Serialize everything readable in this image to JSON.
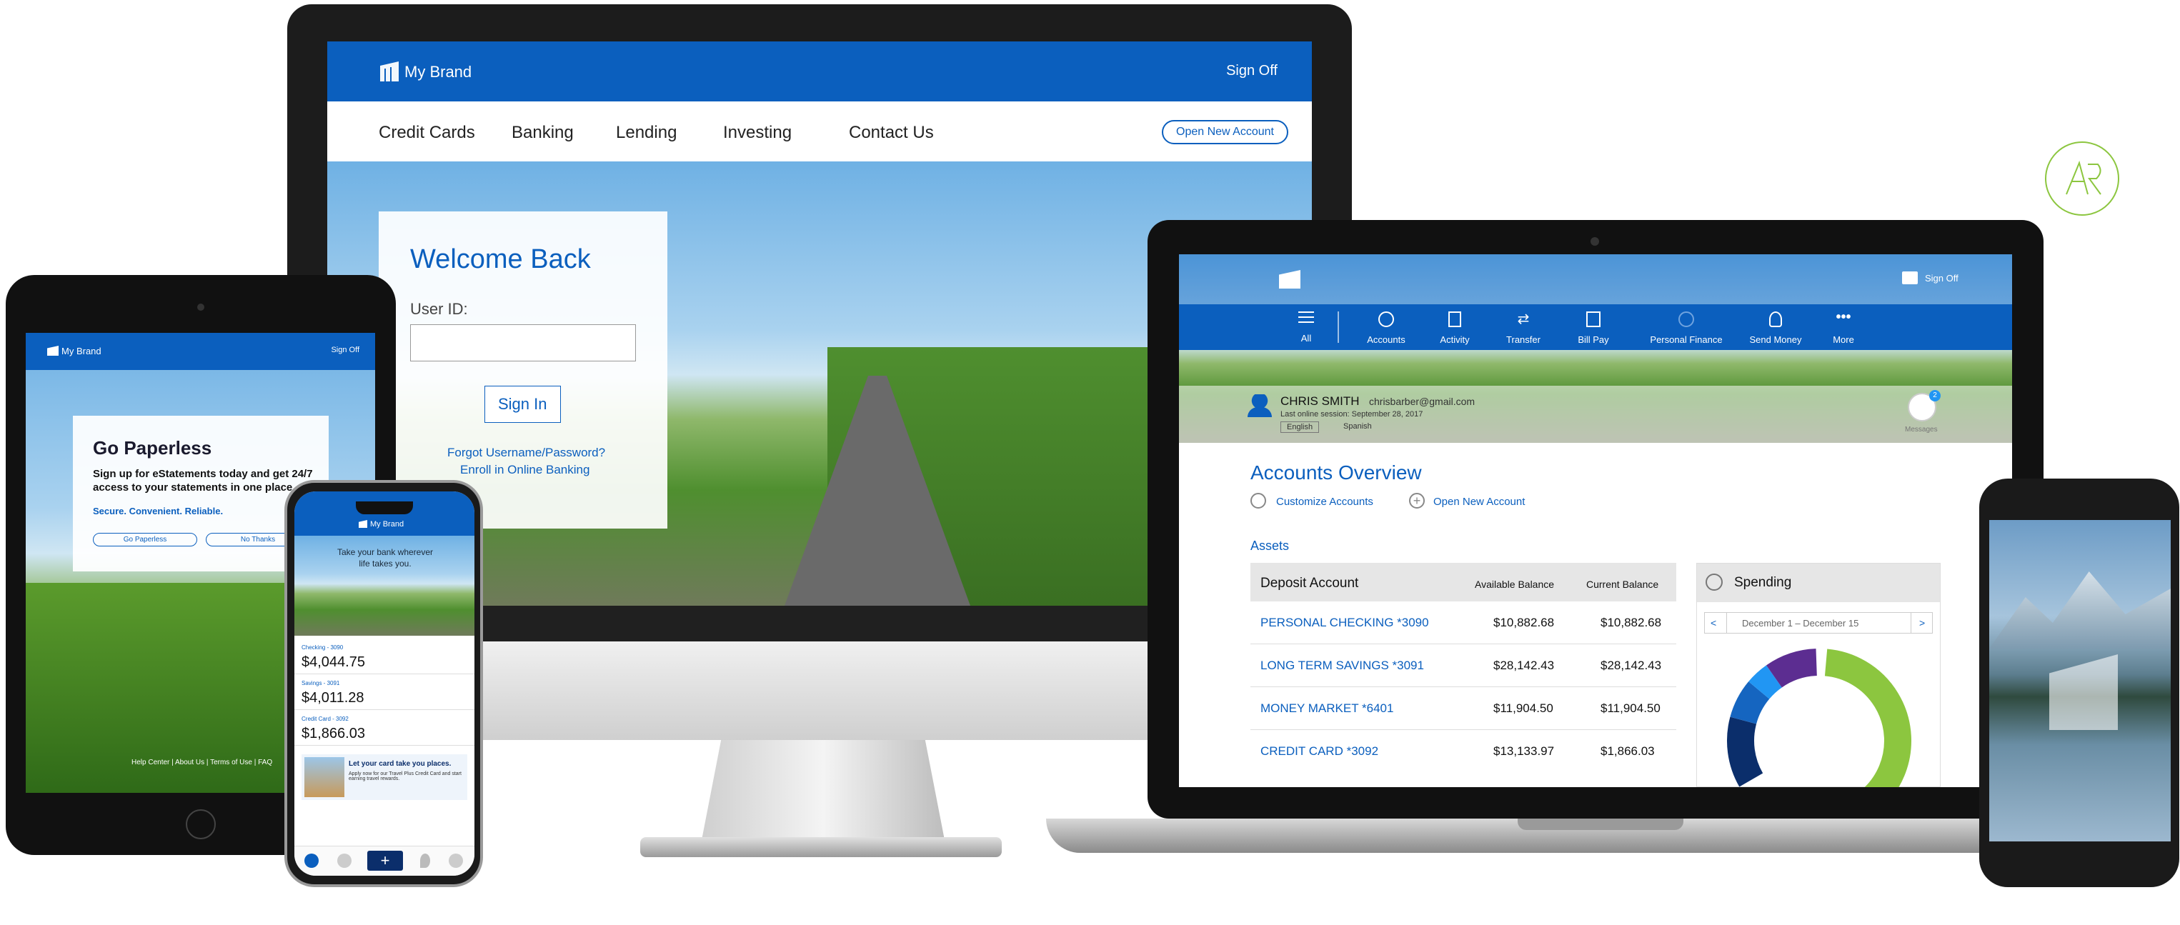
{
  "monitor": {
    "brand": "My Brand",
    "sign_off": "Sign Off",
    "nav": [
      "Credit Cards",
      "Banking",
      "Lending",
      "Investing",
      "Contact Us"
    ],
    "open_account": "Open New Account",
    "login": {
      "title": "Welcome Back",
      "user_label": "User ID:",
      "sign_in": "Sign In",
      "forgot": "Forgot Username/Password?",
      "enroll": "Enroll in Online Banking"
    }
  },
  "laptop": {
    "sign_off": "Sign Off",
    "nav": [
      {
        "label": "All",
        "icon": "menu-icon"
      },
      {
        "label": "Accounts",
        "icon": "accounts-icon"
      },
      {
        "label": "Activity",
        "icon": "activity-icon"
      },
      {
        "label": "Transfer",
        "icon": "transfer-icon"
      },
      {
        "label": "Bill Pay",
        "icon": "bill-pay-icon"
      },
      {
        "label": "Personal Finance",
        "icon": "personal-finance-icon"
      },
      {
        "label": "Send Money",
        "icon": "send-money-icon"
      },
      {
        "label": "More",
        "icon": "more-icon"
      }
    ],
    "user": {
      "name": "CHRIS SMITH",
      "email": "chrisbarber@gmail.com",
      "last_session": "Last online session: September 28, 2017",
      "lang_en": "English",
      "lang_es": "Spanish",
      "messages": "Messages",
      "messages_count": "2"
    },
    "overview_title": "Accounts Overview",
    "customize": "Customize Accounts",
    "open_account": "Open New Account",
    "assets": "Assets",
    "table": {
      "headers": [
        "Deposit Account",
        "Available Balance",
        "Current Balance"
      ],
      "rows": [
        [
          "PERSONAL CHECKING *3090",
          "$10,882.68",
          "$10,882.68"
        ],
        [
          "LONG TERM SAVINGS *3091",
          "$28,142.43",
          "$28,142.43"
        ],
        [
          "MONEY MARKET *6401",
          "$11,904.50",
          "$11,904.50"
        ],
        [
          "CREDIT CARD *3092",
          "$13,133.97",
          "$1,866.03"
        ]
      ]
    },
    "spending": {
      "title": "Spending",
      "range": "December 1 – December 15",
      "prev": "<",
      "next": ">",
      "colors": [
        "#8cc63f",
        "#0b2e6b",
        "#1565c0",
        "#2196f3",
        "#5c2d91"
      ]
    }
  },
  "tablet": {
    "brand": "My Brand",
    "sign_off": "Sign Off",
    "title": "Go Paperless",
    "body": "Sign up for eStatements today and get 24/7 access to your statements in one place.",
    "tagline": "Secure. Convenient. Reliable.",
    "btn_yes": "Go Paperless",
    "btn_no": "No Thanks",
    "footer": "Help Center | About Us | Terms of Use | FAQ"
  },
  "phone": {
    "brand": "My Brand",
    "hero_line1": "Take your bank wherever",
    "hero_line2": "life takes you.",
    "accounts": [
      {
        "label": "Checking - 3090",
        "amount": "$4,044.75"
      },
      {
        "label": "Savings - 3091",
        "amount": "$4,011.28"
      },
      {
        "label": "Credit Card - 3092",
        "amount": "$1,866.03"
      }
    ],
    "promo_title": "Let your card take you places.",
    "promo_body": "Apply now for our Travel Plus Credit Card and start earning travel rewards."
  }
}
